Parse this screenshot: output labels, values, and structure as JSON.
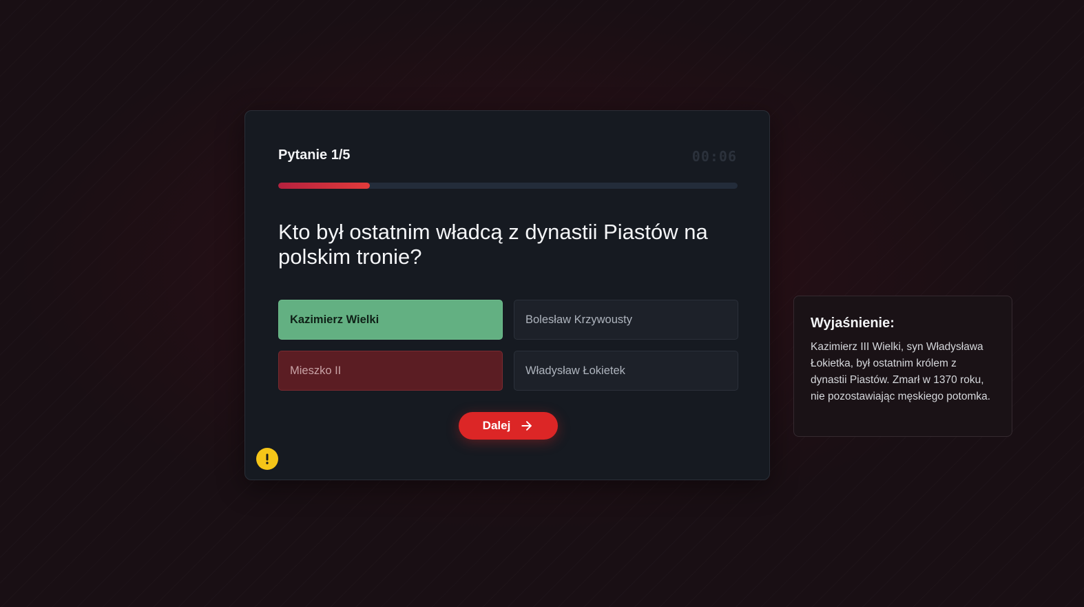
{
  "quiz": {
    "question_counter": "Pytanie 1/5",
    "timer": "00:06",
    "progress": 0.2,
    "question": "Kto był ostatnim władcą z dynastii Piastów na polskim tronie?",
    "answers": [
      {
        "label": "Kazimierz Wielki",
        "state": "correct"
      },
      {
        "label": "Bolesław Krzywousty",
        "state": "neutral"
      },
      {
        "label": "Mieszko II",
        "state": "wrong"
      },
      {
        "label": "Władysław Łokietek",
        "state": "neutral"
      }
    ],
    "next_label": "Dalej",
    "next_icon": "arrow-right-icon",
    "report_icon": "exclamation-icon"
  },
  "explanation": {
    "title": "Wyjaśnienie:",
    "text": "Kazimierz III Wielki, syn Władysława Łokietka, był ostatnim królem z dynastii Piastów. Zmarł w 1370 roku, nie pozostawiając męskiego potomka."
  },
  "colors": {
    "accent": "#dc2626",
    "correct": "#63b082",
    "wrong": "#5b1d23",
    "warning": "#f5c518"
  }
}
